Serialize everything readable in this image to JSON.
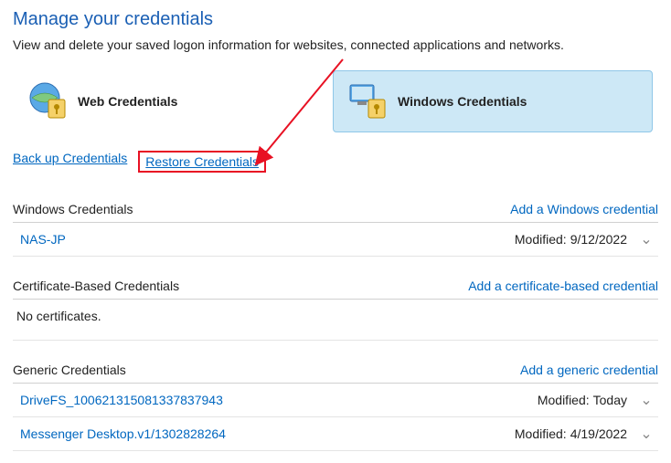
{
  "title": "Manage your credentials",
  "subtitle": "View and delete your saved logon information for websites, connected applications and networks.",
  "tabs": {
    "web": "Web Credentials",
    "windows": "Windows Credentials"
  },
  "links": {
    "backup": "Back up Credentials",
    "restore": "Restore Credentials"
  },
  "sections": {
    "windows": {
      "title": "Windows Credentials",
      "add": "Add a Windows credential",
      "items": [
        {
          "name": "NAS-JP",
          "mod_label": "Modified:",
          "mod_value": "9/12/2022"
        }
      ]
    },
    "cert": {
      "title": "Certificate-Based Credentials",
      "add": "Add a certificate-based credential",
      "empty": "No certificates."
    },
    "generic": {
      "title": "Generic Credentials",
      "add": "Add a generic credential",
      "items": [
        {
          "name": "DriveFS_100621315081337837943",
          "mod_label": "Modified:",
          "mod_value": "Today"
        },
        {
          "name": "Messenger Desktop.v1/1302828264",
          "mod_label": "Modified:",
          "mod_value": "4/19/2022"
        }
      ]
    }
  }
}
